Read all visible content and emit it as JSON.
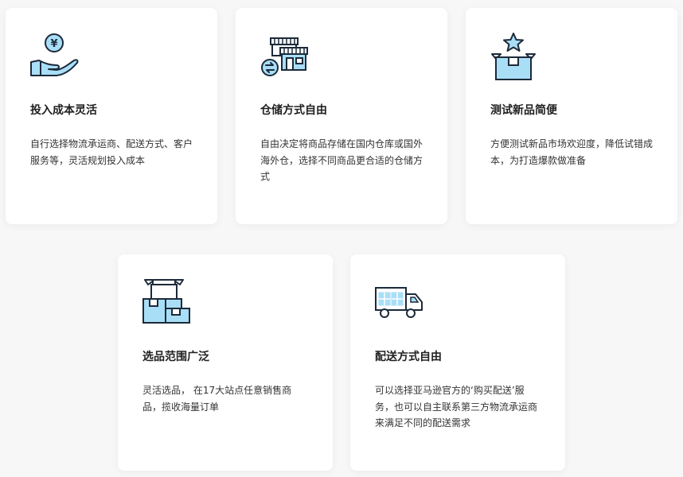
{
  "colors": {
    "background": "#f7f7f8",
    "card": "#ffffff",
    "icon_fill": "#a9def7",
    "icon_stroke": "#1c2a3a"
  },
  "features": [
    {
      "icon": "hand-coin-icon",
      "icon_text": "¥",
      "title": "投入成本灵活",
      "description": "自行选择物流承运商、配送方式、客户服务等，灵活规划投入成本"
    },
    {
      "icon": "warehouse-exchange-icon",
      "title": "仓储方式自由",
      "description": "自由决定将商品存储在国内仓库或国外海外仓，选择不同商品更合适的仓储方式"
    },
    {
      "icon": "star-box-icon",
      "title": "测试新品简便",
      "description": "方便测试新品市场欢迎度，降低试错成本，为打造爆款做准备"
    },
    {
      "icon": "boxes-icon",
      "title": "选品范围广泛",
      "description": "灵活选品， 在17大站点任意销售商品，揽收海量订单"
    },
    {
      "icon": "delivery-truck-icon",
      "title": "配送方式自由",
      "description": "可以选择亚马逊官方的‘购买配送’服务，也可以自主联系第三方物流承运商来满足不同的配送需求"
    }
  ]
}
